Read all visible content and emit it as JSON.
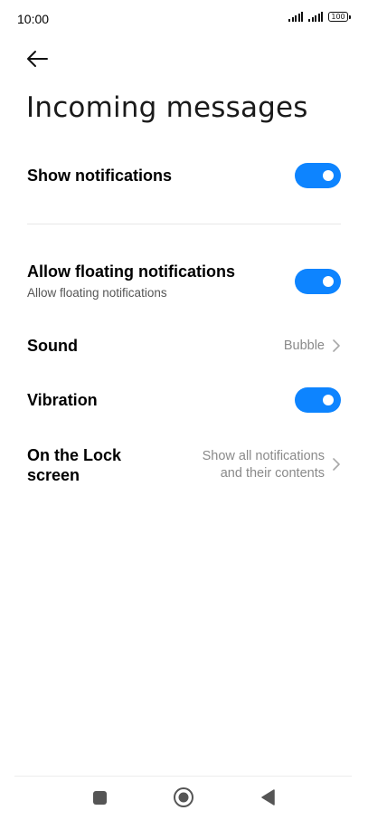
{
  "status_bar": {
    "time": "10:00",
    "battery_level": "100",
    "signal_icons": [
      "signal-bars-icon",
      "signal-bars-icon"
    ]
  },
  "header": {
    "back_icon": "arrow-left-icon",
    "title": "Incoming messages"
  },
  "settings": {
    "show_notifications": {
      "label": "Show notifications",
      "enabled": true
    },
    "allow_floating": {
      "label": "Allow floating notifications",
      "sublabel": "Allow floating notifications",
      "enabled": true
    },
    "sound": {
      "label": "Sound",
      "value": "Bubble"
    },
    "vibration": {
      "label": "Vibration",
      "enabled": true
    },
    "lock_screen": {
      "label_line1": "On the Lock",
      "label_line2": "screen",
      "value_line1": "Show all notifications",
      "value_line2": "and their contents"
    }
  },
  "nav": {
    "recents_icon": "square-icon",
    "home_icon": "circle-icon",
    "back_icon": "triangle-back-icon"
  },
  "colors": {
    "accent": "#0d84ff",
    "secondary_text": "#8a8a8a"
  }
}
